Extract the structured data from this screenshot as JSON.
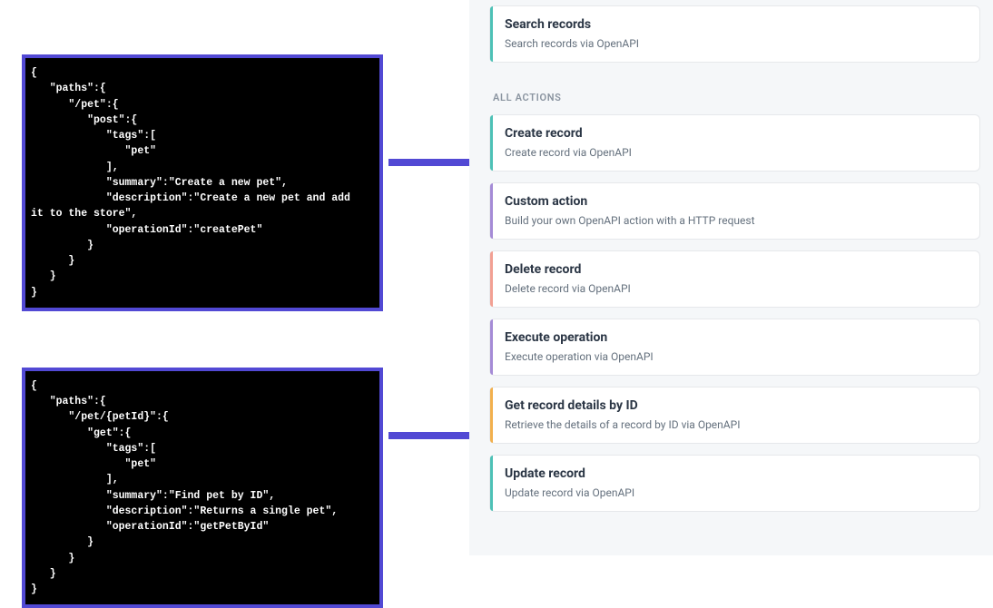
{
  "code1": "{\n   \"paths\":{\n      \"/pet\":{\n         \"post\":{\n            \"tags\":[\n               \"pet\"\n            ],\n            \"summary\":\"Create a new pet\",\n            \"description\":\"Create a new pet and add \nit to the store\",\n            \"operationId\":\"createPet\"\n         }\n      }\n   }\n}",
  "code2": "{\n   \"paths\":{\n      \"/pet/{petId}\":{\n         \"get\":{\n            \"tags\":[\n               \"pet\"\n            ],\n            \"summary\":\"Find pet by ID\",\n            \"description\":\"Returns a single pet\",\n            \"operationId\":\"getPetById\"\n         }\n      }\n   }\n}",
  "featured": {
    "title": "Search records",
    "desc": "Search records via OpenAPI"
  },
  "section_label": "ALL ACTIONS",
  "actions": [
    {
      "title": "Create record",
      "desc": "Create record via OpenAPI",
      "stripe": "teal"
    },
    {
      "title": "Custom action",
      "desc": "Build your own OpenAPI action with a HTTP request",
      "stripe": "purple"
    },
    {
      "title": "Delete record",
      "desc": "Delete record via OpenAPI",
      "stripe": "salmon"
    },
    {
      "title": "Execute operation",
      "desc": "Execute operation via OpenAPI",
      "stripe": "purple"
    },
    {
      "title": "Get record details by ID",
      "desc": "Retrieve the details of a record by ID via OpenAPI",
      "stripe": "orange"
    },
    {
      "title": "Update record",
      "desc": "Update record via OpenAPI",
      "stripe": "teal"
    }
  ],
  "colors": {
    "arrow": "#5249d4",
    "check": "#2fb344"
  }
}
